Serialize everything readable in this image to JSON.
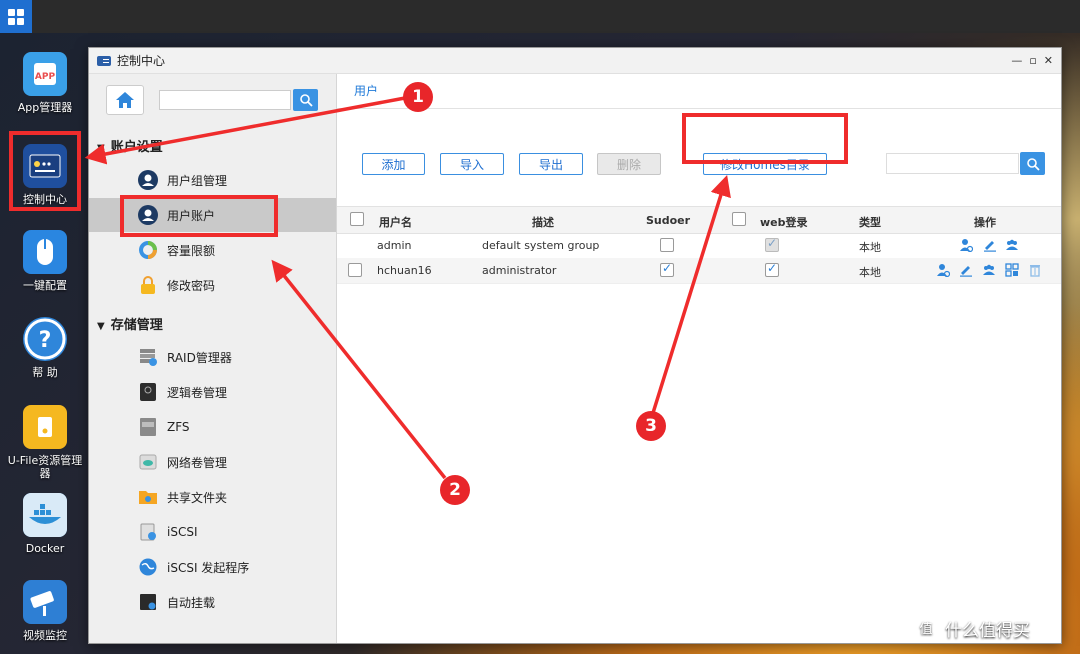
{
  "desktop": {
    "icons": [
      {
        "label": "App管理器",
        "badge": "APP"
      },
      {
        "label": "控制中心"
      },
      {
        "label": "一键配置"
      },
      {
        "label": "帮 助",
        "symbol": "?"
      },
      {
        "label": "U-File资源管理器"
      },
      {
        "label": "Docker"
      },
      {
        "label": "视频监控"
      }
    ]
  },
  "window": {
    "title": "控制中心",
    "controls": {
      "min": "—",
      "max": "▫",
      "close": "✕"
    }
  },
  "sidebar": {
    "sections": [
      {
        "title": "账户设置",
        "items": [
          "用户组管理",
          "用户账户",
          "容量限额",
          "修改密码"
        ]
      },
      {
        "title": "存储管理",
        "items": [
          "RAID管理器",
          "逻辑卷管理",
          "ZFS",
          "网络卷管理",
          "共享文件夹",
          "iSCSI",
          "iSCSI 发起程序",
          "自动挂载"
        ]
      }
    ],
    "active_item": "用户账户"
  },
  "main": {
    "tab": "用户",
    "buttons": {
      "add": "添加",
      "import": "导入",
      "export": "导出",
      "delete": "删除",
      "homes": "修改Homes目录"
    },
    "table": {
      "columns": [
        "用户名",
        "描述",
        "Sudoer",
        "web登录",
        "类型",
        "操作"
      ],
      "rows": [
        {
          "username": "admin",
          "description": "default system group",
          "sudoer": false,
          "web_login": true,
          "type": "本地"
        },
        {
          "username": "hchuan16",
          "description": "administrator",
          "sudoer": true,
          "web_login": true,
          "type": "本地"
        }
      ]
    }
  },
  "annotations": {
    "markers": [
      "1",
      "2",
      "3"
    ],
    "color": "#ef2c2c"
  },
  "watermark": {
    "text": "什么值得买",
    "glyph": "值"
  },
  "colors": {
    "accent": "#1f7ad8",
    "button_blue": "#3a93e3",
    "active_nav": "#c9c9c9"
  }
}
